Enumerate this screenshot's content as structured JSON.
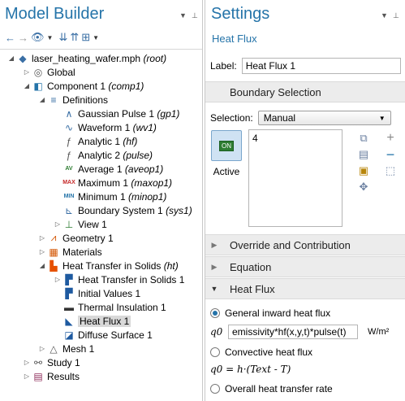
{
  "model_builder": {
    "title": "Model Builder",
    "tree": [
      {
        "indent": 0,
        "arrow": "down",
        "icon": "model-file-icon",
        "label": "laser_heating_wafer.mph",
        "tag": "(root)",
        "name": "tree-item-root"
      },
      {
        "indent": 1,
        "arrow": "right",
        "icon": "globe-icon",
        "label": "Global",
        "tag": "",
        "name": "tree-item-global"
      },
      {
        "indent": 1,
        "arrow": "down",
        "icon": "component-icon",
        "label": "Component 1",
        "tag": "(comp1)",
        "name": "tree-item-component"
      },
      {
        "indent": 2,
        "arrow": "down",
        "icon": "definitions-icon",
        "label": "Definitions",
        "tag": "",
        "name": "tree-item-definitions"
      },
      {
        "indent": 3,
        "arrow": "",
        "icon": "gaussian-pulse-icon",
        "label": "Gaussian Pulse 1",
        "tag": "(gp1)",
        "name": "tree-item-gaussian-pulse"
      },
      {
        "indent": 3,
        "arrow": "",
        "icon": "waveform-icon",
        "label": "Waveform 1",
        "tag": "(wv1)",
        "name": "tree-item-waveform"
      },
      {
        "indent": 3,
        "arrow": "",
        "icon": "analytic-function-icon",
        "label": "Analytic 1",
        "tag": "(hf)",
        "name": "tree-item-analytic-1"
      },
      {
        "indent": 3,
        "arrow": "",
        "icon": "analytic-function-icon",
        "label": "Analytic 2",
        "tag": "(pulse)",
        "name": "tree-item-analytic-2"
      },
      {
        "indent": 3,
        "arrow": "",
        "icon": "average-icon",
        "label": "Average 1",
        "tag": "(aveop1)",
        "name": "tree-item-average"
      },
      {
        "indent": 3,
        "arrow": "",
        "icon": "maximum-icon",
        "label": "Maximum 1",
        "tag": "(maxop1)",
        "name": "tree-item-maximum"
      },
      {
        "indent": 3,
        "arrow": "",
        "icon": "minimum-icon",
        "label": "Minimum 1",
        "tag": "(minop1)",
        "name": "tree-item-minimum"
      },
      {
        "indent": 3,
        "arrow": "",
        "icon": "boundary-system-icon",
        "label": "Boundary System 1",
        "tag": "(sys1)",
        "name": "tree-item-boundary-system"
      },
      {
        "indent": 3,
        "arrow": "right",
        "icon": "view-icon",
        "label": "View 1",
        "tag": "",
        "name": "tree-item-view"
      },
      {
        "indent": 2,
        "arrow": "right",
        "icon": "geometry-icon",
        "label": "Geometry 1",
        "tag": "",
        "name": "tree-item-geometry"
      },
      {
        "indent": 2,
        "arrow": "right",
        "icon": "materials-icon",
        "label": "Materials",
        "tag": "",
        "name": "tree-item-materials"
      },
      {
        "indent": 2,
        "arrow": "down",
        "icon": "heat-transfer-icon",
        "label": "Heat Transfer in Solids",
        "tag": "(ht)",
        "name": "tree-item-heat-transfer"
      },
      {
        "indent": 3,
        "arrow": "right",
        "icon": "physics-node-icon",
        "label": "Heat Transfer in Solids 1",
        "tag": "",
        "name": "tree-item-ht-solids-1"
      },
      {
        "indent": 3,
        "arrow": "",
        "icon": "physics-node-icon",
        "label": "Initial Values 1",
        "tag": "",
        "name": "tree-item-initial-values"
      },
      {
        "indent": 3,
        "arrow": "",
        "icon": "thermal-insulation-icon",
        "label": "Thermal Insulation 1",
        "tag": "",
        "name": "tree-item-thermal-insulation"
      },
      {
        "indent": 3,
        "arrow": "",
        "icon": "heat-flux-icon",
        "label": "Heat Flux 1",
        "tag": "",
        "name": "tree-item-heat-flux",
        "selected": true
      },
      {
        "indent": 3,
        "arrow": "",
        "icon": "diffuse-surface-icon",
        "label": "Diffuse Surface 1",
        "tag": "",
        "name": "tree-item-diffuse-surface"
      },
      {
        "indent": 2,
        "arrow": "right",
        "icon": "mesh-icon",
        "label": "Mesh 1",
        "tag": "",
        "name": "tree-item-mesh"
      },
      {
        "indent": 1,
        "arrow": "right",
        "icon": "study-icon",
        "label": "Study 1",
        "tag": "",
        "name": "tree-item-study"
      },
      {
        "indent": 1,
        "arrow": "right",
        "icon": "results-icon",
        "label": "Results",
        "tag": "",
        "name": "tree-item-results"
      }
    ]
  },
  "settings": {
    "title": "Settings",
    "subtitle": "Heat Flux",
    "label_caption": "Label:",
    "label_value": "Heat Flux 1",
    "boundary_selection": "Boundary Selection",
    "selection_caption": "Selection:",
    "selection_value": "Manual",
    "toggle_text": "ON",
    "active_label": "Active",
    "selected_boundary": "4",
    "override": "Override and Contribution",
    "equation": "Equation",
    "heat_flux_section": "Heat Flux",
    "opt_general": "General inward heat flux",
    "q0_symbol": "q0",
    "expression": "emissivity*hf(x,y,t)*pulse(t)",
    "unit": "W/m²",
    "opt_convective": "Convective heat flux",
    "formula": "q0 = h·(Text - T)",
    "opt_overall": "Overall heat transfer rate"
  }
}
